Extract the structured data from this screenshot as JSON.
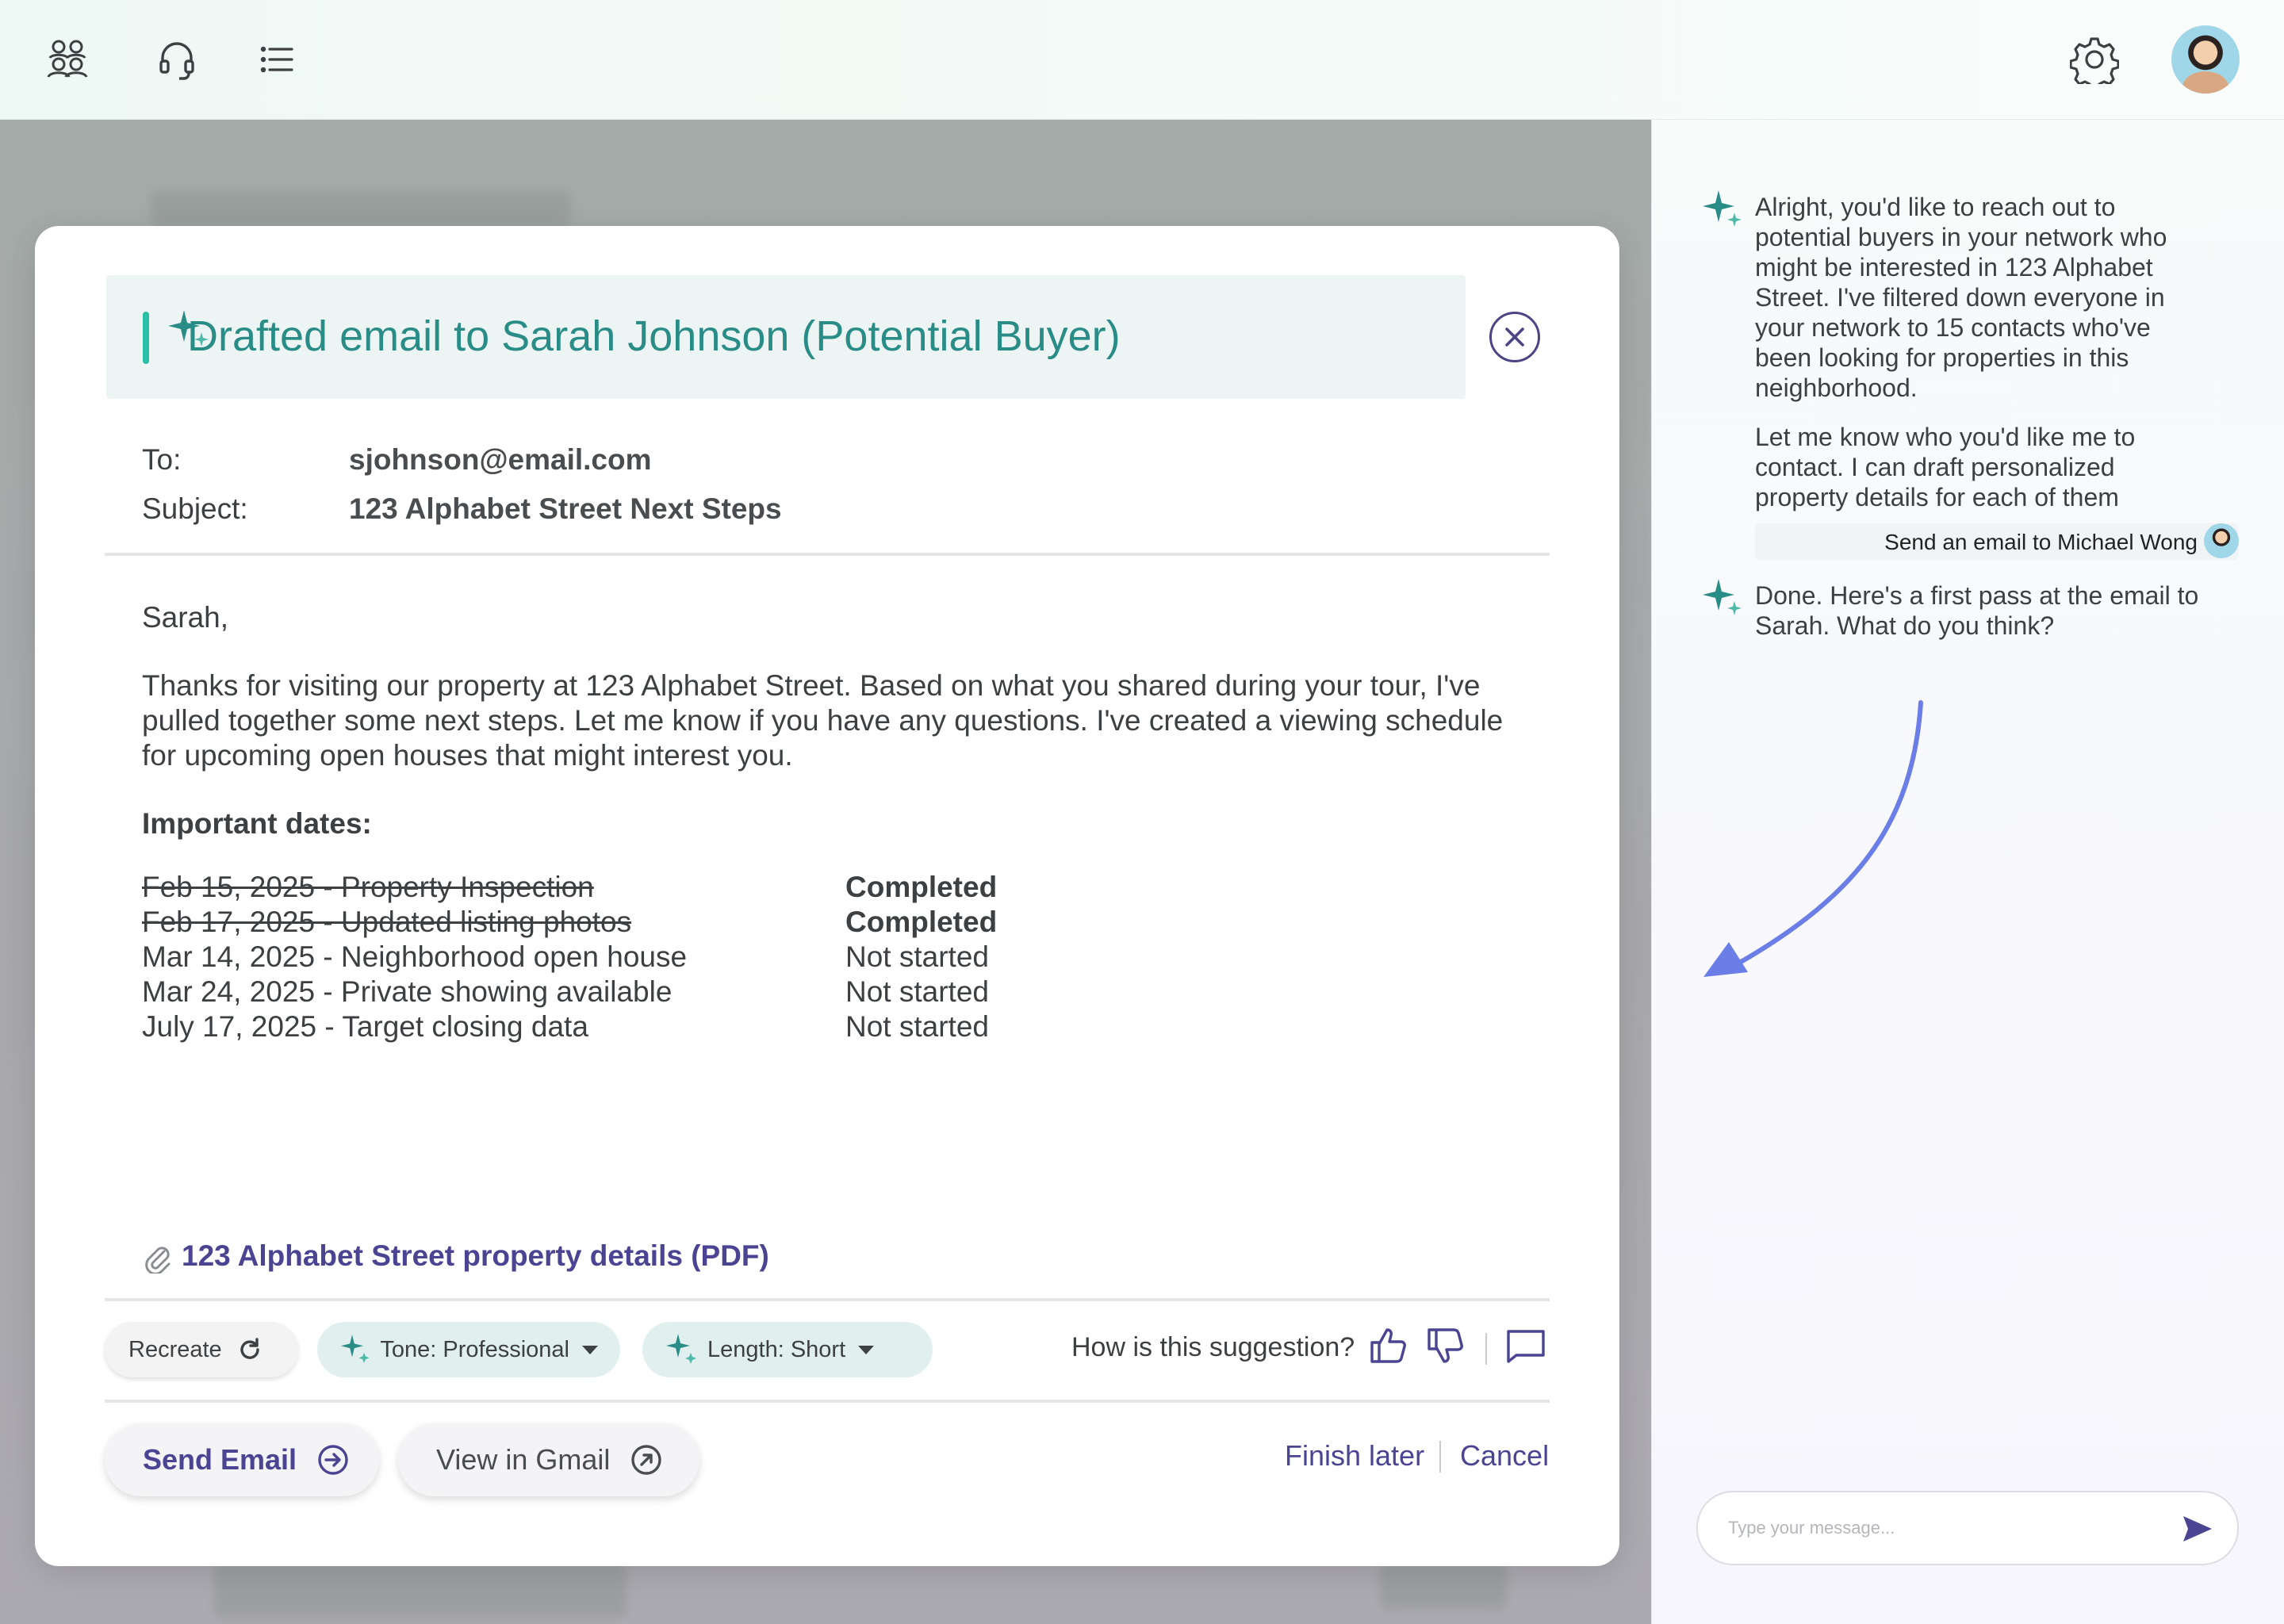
{
  "topbar": {
    "icons": [
      "people-icon",
      "headset-icon",
      "list-icon",
      "gear-icon"
    ]
  },
  "chat": {
    "assistant_message_1": [
      "Alright, you'd like to reach out to potential buyers in your network who might be interested in 123 Alphabet Street. I've filtered down everyone in your network to 15 contacts who've been looking for properties in this neighborhood.",
      "Let me know who you'd like me to contact. I can draft personalized property details for each of them"
    ],
    "user_message": "Send an email to Michael Wong",
    "assistant_message_2": "Done. Here's a first pass at the email to Sarah. What do you think?",
    "input_placeholder": "Type your message..."
  },
  "email": {
    "title": "Drafted email to Sarah Johnson (Potential Buyer)",
    "to_label": "To:",
    "to_value": "sjohnson@email.com",
    "subject_label": "Subject:",
    "subject_value": "123 Alphabet Street Next Steps",
    "greeting": "Sarah,",
    "body": "Thanks for visiting our property at 123 Alphabet Street. Based on what you shared during your tour, I've pulled together some next steps. Let me know if you have any questions. I've created a viewing schedule for upcoming open houses that might interest you.",
    "dates_heading": "Important dates:",
    "dates": [
      {
        "date": "Feb 15, 2025 - Property Inspection",
        "status": "Completed",
        "done": true
      },
      {
        "date": "Feb 17, 2025 - Updated listing photos",
        "status": "Completed",
        "done": true
      },
      {
        "date": "Mar 14, 2025 - Neighborhood open house",
        "status": "Not started",
        "done": false
      },
      {
        "date": "Mar 24, 2025 - Private showing available",
        "status": "Not started",
        "done": false
      },
      {
        "date": "July 17, 2025 - Target closing data",
        "status": "Not started",
        "done": false
      }
    ],
    "attachment": "123 Alphabet Street property details (PDF)"
  },
  "toolbar": {
    "recreate": "Recreate",
    "tone": "Tone: Professional",
    "length": "Length: Short",
    "feedback_prompt": "How is this suggestion?"
  },
  "actions": {
    "send": "Send Email",
    "gmail": "View in Gmail",
    "finish_later": "Finish later",
    "cancel": "Cancel"
  },
  "colors": {
    "accent_teal": "#2a8c86",
    "accent_purple": "#4b4492",
    "arrow_blue": "#6b7ee8"
  }
}
